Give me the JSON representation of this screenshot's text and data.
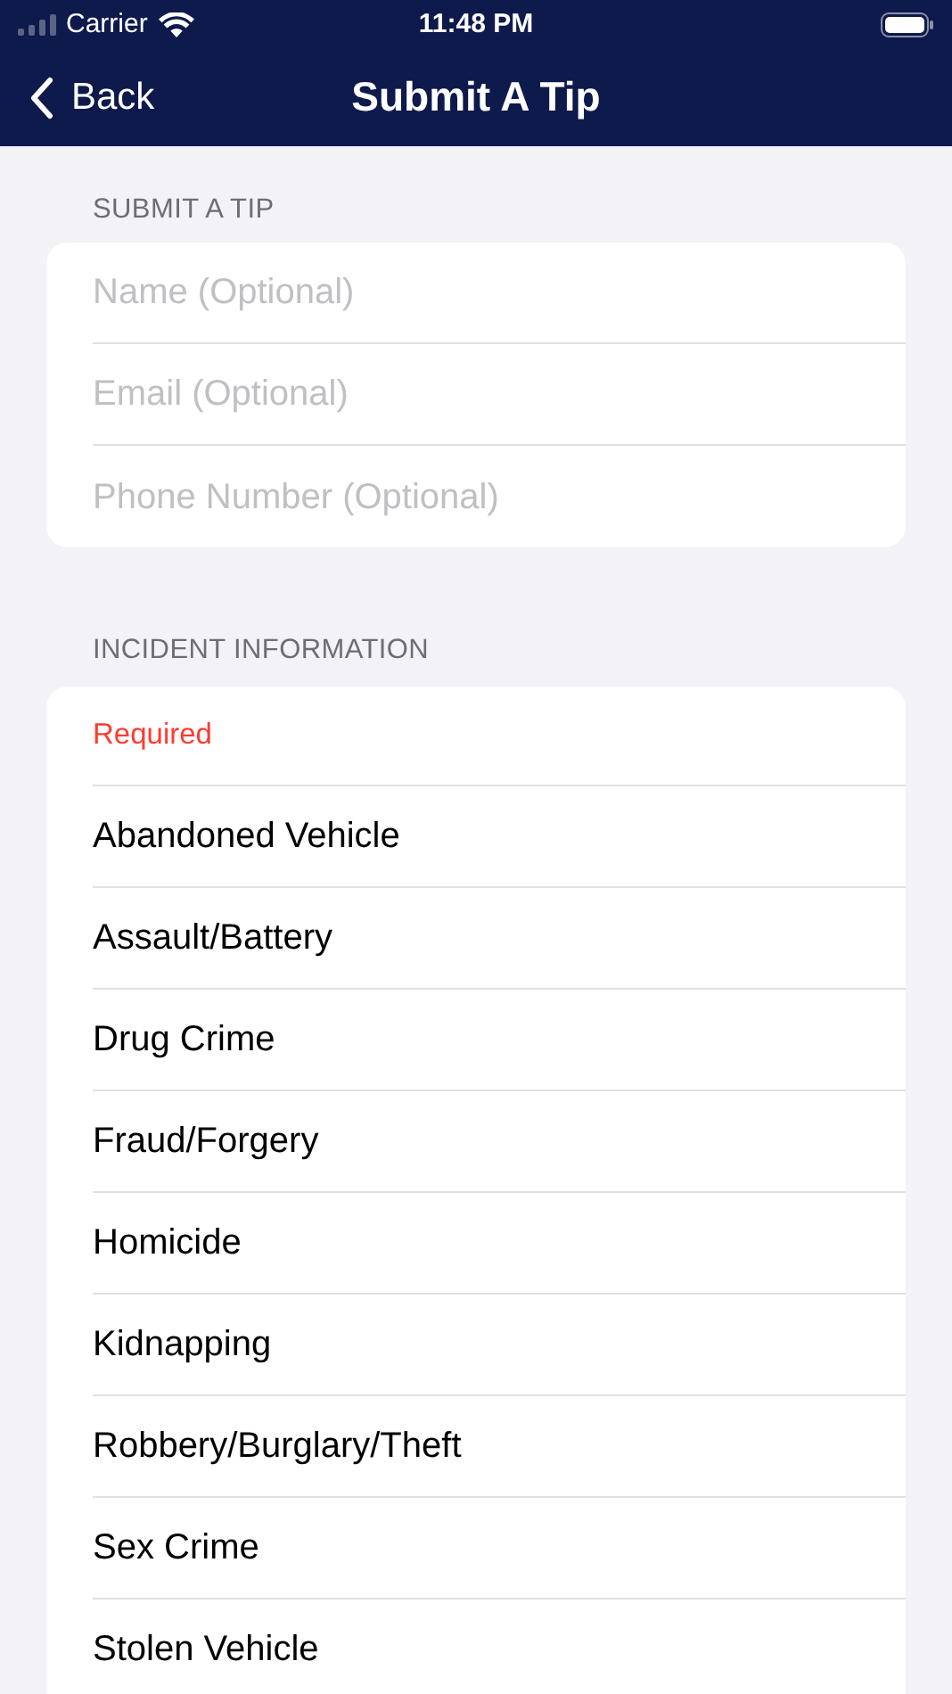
{
  "status_bar": {
    "carrier": "Carrier",
    "time": "11:48 PM"
  },
  "nav_bar": {
    "back": "Back",
    "title": "Submit A Tip"
  },
  "contact_section": {
    "header": "SUBMIT A TIP",
    "fields": [
      {
        "placeholder": "Name (Optional)"
      },
      {
        "placeholder": "Email (Optional)"
      },
      {
        "placeholder": "Phone Number (Optional)"
      }
    ]
  },
  "incident_section": {
    "header": "INCIDENT INFORMATION",
    "note": "Required",
    "items": [
      {
        "label": "Abandoned Vehicle"
      },
      {
        "label": "Assault/Battery"
      },
      {
        "label": "Drug Crime"
      },
      {
        "label": "Fraud/Forgery"
      },
      {
        "label": "Homicide"
      },
      {
        "label": "Kidnapping"
      },
      {
        "label": "Robbery/Burglary/Theft"
      },
      {
        "label": "Sex Crime"
      },
      {
        "label": "Stolen Vehicle"
      }
    ]
  }
}
